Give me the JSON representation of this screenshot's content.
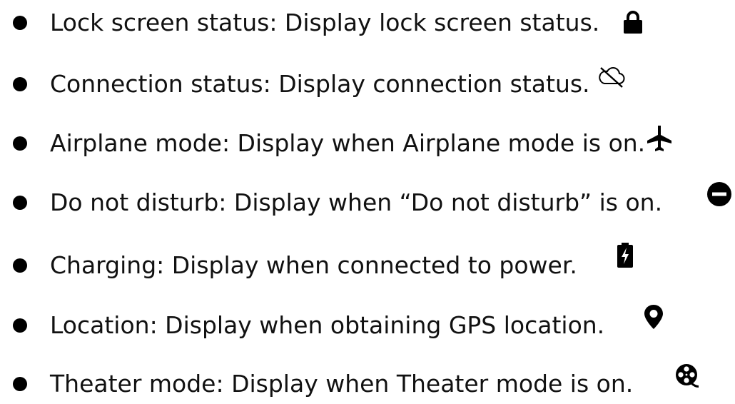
{
  "items": [
    {
      "label": "Lock screen status: Display lock screen status.",
      "icon": "lock-icon"
    },
    {
      "label": "Connection status: Display connection status.",
      "icon": "cloud-off-icon"
    },
    {
      "label": "Airplane mode: Display when Airplane mode is on.",
      "icon": "airplane-icon"
    },
    {
      "label": "Do not disturb: Display when “Do not disturb” is on.",
      "icon": "do-not-disturb-icon"
    },
    {
      "label": "Charging: Display when connected to power.",
      "icon": "battery-charging-icon"
    },
    {
      "label": "Location: Display when obtaining GPS location.",
      "icon": "location-pin-icon"
    },
    {
      "label": "Theater mode: Display when Theater mode is on.",
      "icon": "theater-mode-icon"
    }
  ],
  "colors": {
    "text": "#111111",
    "icon": "#000000"
  }
}
